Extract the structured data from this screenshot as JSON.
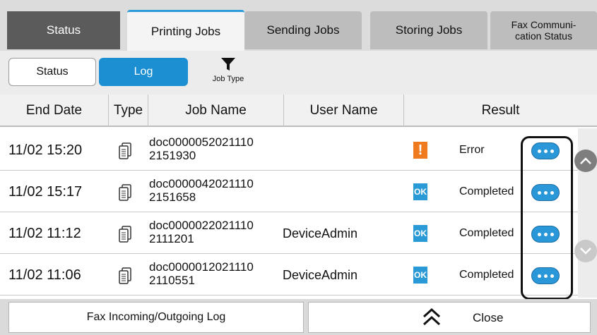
{
  "tabs": {
    "status": "Status",
    "printing_jobs": "Printing Jobs",
    "sending_jobs": "Sending Jobs",
    "storing_jobs": "Storing Jobs",
    "fax_comm_line1": "Fax Communi-",
    "fax_comm_line2": "cation Status",
    "active": "printing_jobs"
  },
  "toolbar": {
    "status_label": "Status",
    "log_label": "Log",
    "job_type_label": "Job Type",
    "job_type_icon": "filter-icon"
  },
  "table": {
    "headers": [
      "End Date",
      "Type",
      "Job Name",
      "User Name",
      "Result"
    ],
    "rows": [
      {
        "end_date": "11/02 15:20",
        "type_icon": "document-icon",
        "job_name_1": "doc0000052021110",
        "job_name_2": "2151930",
        "user_name": "",
        "result_icon": "error-icon",
        "result_glyph": "!",
        "result": "Error"
      },
      {
        "end_date": "11/02 15:17",
        "type_icon": "document-icon",
        "job_name_1": "doc0000042021110",
        "job_name_2": "2151658",
        "user_name": "",
        "result_icon": "ok-icon",
        "result_glyph": "OK",
        "result": "Completed"
      },
      {
        "end_date": "11/02 11:12",
        "type_icon": "document-icon",
        "job_name_1": "doc0000022021110",
        "job_name_2": "2111201",
        "user_name": "DeviceAdmin",
        "result_icon": "ok-icon",
        "result_glyph": "OK",
        "result": "Completed"
      },
      {
        "end_date": "11/02 11:06",
        "type_icon": "document-icon",
        "job_name_1": "doc0000012021110",
        "job_name_2": "2110551",
        "user_name": "DeviceAdmin",
        "result_icon": "ok-icon",
        "result_glyph": "OK",
        "result": "Completed"
      }
    ]
  },
  "bottom": {
    "fax_log_label": "Fax Incoming/Outgoing Log",
    "close_label": "Close"
  },
  "colors": {
    "accent_blue": "#2a98d8",
    "error_orange": "#f07b1f",
    "status_tab": "#5b5b5b"
  }
}
